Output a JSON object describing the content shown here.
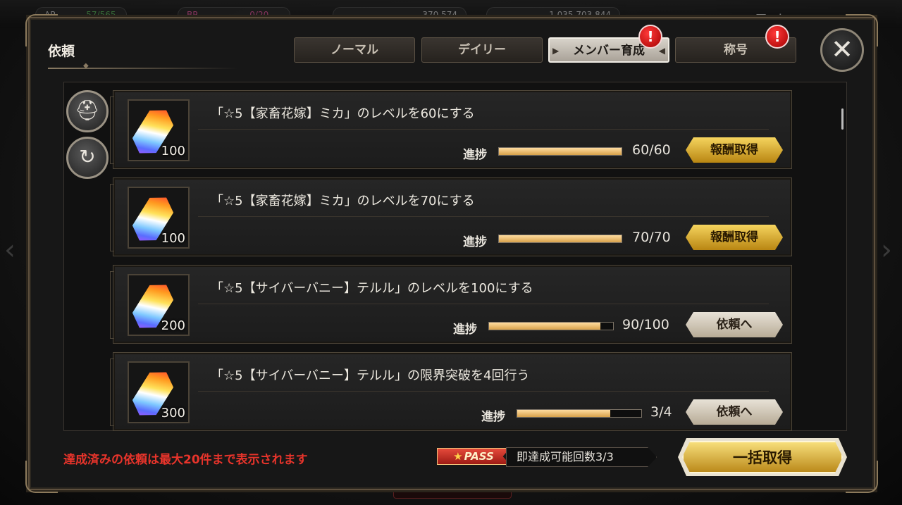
{
  "topbar": {
    "ap_label": "AP",
    "ap_value": "57/565",
    "bp_label": "BP",
    "bp_value": "0/20",
    "currency1": "370,574",
    "currency2": "1,035,703,844",
    "menu_label": "メニュー"
  },
  "modal": {
    "title": "依頼",
    "tabs": [
      {
        "label": "ノーマル",
        "active": false,
        "alert": false
      },
      {
        "label": "デイリー",
        "active": false,
        "alert": false
      },
      {
        "label": "メンバー育成",
        "active": true,
        "alert": true
      },
      {
        "label": "称号",
        "active": false,
        "alert": true
      }
    ],
    "alert_glyph": "!",
    "close_glyph": "✕"
  },
  "quests": [
    {
      "title": "「☆5【家畜花嫁】ミカ」のレベルを60にする",
      "reward_count": "100",
      "progress_label": "進捗",
      "progress_text": "60/60",
      "progress": 1.0,
      "button_label": "報酬取得",
      "button_type": "claim"
    },
    {
      "title": "「☆5【家畜花嫁】ミカ」のレベルを70にする",
      "reward_count": "100",
      "progress_label": "進捗",
      "progress_text": "70/70",
      "progress": 1.0,
      "button_label": "報酬取得",
      "button_type": "claim"
    },
    {
      "title": "「☆5【サイバーバニー】テルル」のレベルを100にする",
      "reward_count": "200",
      "progress_label": "進捗",
      "progress_text": "90/100",
      "progress": 0.9,
      "button_label": "依頼へ",
      "button_type": "go"
    },
    {
      "title": "「☆5【サイバーバニー】テルル」の限界突破を4回行う",
      "reward_count": "300",
      "progress_label": "進捗",
      "progress_text": "3/4",
      "progress": 0.75,
      "button_label": "依頼へ",
      "button_type": "go"
    }
  ],
  "footer": {
    "note": "達成済みの依頼は最大20件まで表示されます",
    "pass_label": "PASS",
    "instant_text": "即達成可能回数3/3",
    "bulk_button": "一括取得"
  },
  "colors": {
    "accent_gold": "#d8a24b",
    "claim_button": "#f5d45e",
    "alert_red": "#d10000",
    "note_red": "#e8342b"
  },
  "icons": [
    "helmet-icon",
    "refresh-icon",
    "crystal-icon",
    "close-icon",
    "alert-icon",
    "star-icon"
  ]
}
